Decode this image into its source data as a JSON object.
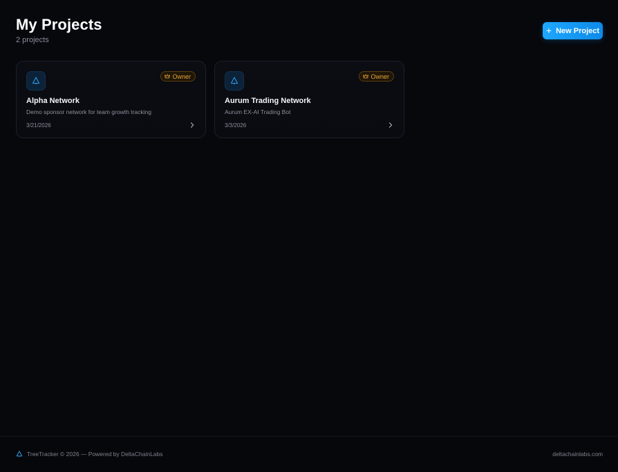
{
  "header": {
    "title": "My Projects",
    "count_label": "2 projects",
    "new_project_label": "New Project"
  },
  "projects": [
    {
      "icon": "tree-icon",
      "role": "Owner",
      "name": "Alpha Network",
      "description": "Demo sponsor network for team growth tracking",
      "date": "3/21/2026"
    },
    {
      "icon": "tree-icon",
      "role": "Owner",
      "name": "Aurum Trading Network",
      "description": "Aurum EX-AI Trading Bot",
      "date": "3/3/2026"
    }
  ],
  "footer": {
    "left_text": "TreeTracker © 2026 — Powered by DeltaChainLabs",
    "right_text": "deltachainlabs.com"
  },
  "colors": {
    "background": "#07080c",
    "accent": "#1ea7ff",
    "owner_badge": "#e8a53a"
  }
}
